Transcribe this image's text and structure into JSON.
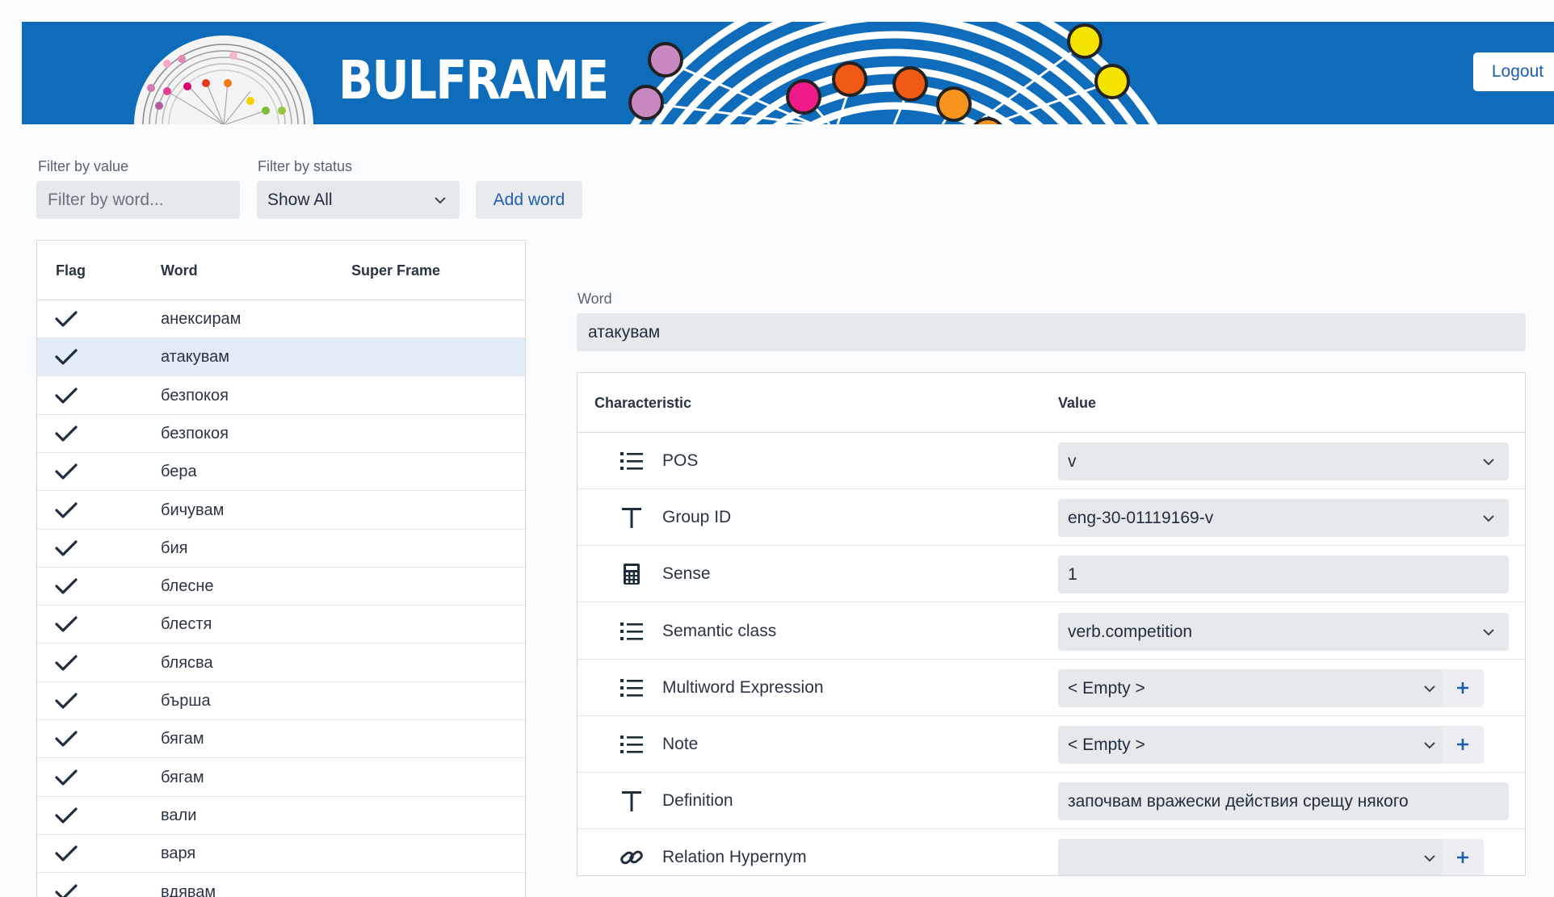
{
  "header": {
    "logo_text": "BULFRAME",
    "logout_label": "Logout"
  },
  "filters": {
    "value_label": "Filter by value",
    "value_placeholder": "Filter by word...",
    "status_label": "Filter by status",
    "status_selected": "Show All",
    "add_word_label": "Add word"
  },
  "word_table": {
    "columns": [
      "Flag",
      "Word",
      "Super Frame"
    ],
    "rows": [
      {
        "word": "анексирам",
        "selected": false
      },
      {
        "word": "атакувам",
        "selected": true
      },
      {
        "word": "безпокоя",
        "selected": false
      },
      {
        "word": "безпокоя",
        "selected": false
      },
      {
        "word": "бера",
        "selected": false
      },
      {
        "word": "бичувам",
        "selected": false
      },
      {
        "word": "бия",
        "selected": false
      },
      {
        "word": "блесне",
        "selected": false
      },
      {
        "word": "блестя",
        "selected": false
      },
      {
        "word": "блясва",
        "selected": false
      },
      {
        "word": "бърша",
        "selected": false
      },
      {
        "word": "бягам",
        "selected": false
      },
      {
        "word": "бягам",
        "selected": false
      },
      {
        "word": "вали",
        "selected": false
      },
      {
        "word": "варя",
        "selected": false
      },
      {
        "word": "вдявам",
        "selected": false
      }
    ]
  },
  "detail": {
    "word_label": "Word",
    "word_value": "атакувам",
    "columns": [
      "Characteristic",
      "Value"
    ],
    "rows": [
      {
        "icon": "list-icon",
        "name": "POS",
        "value": "v",
        "kind": "select",
        "add": false
      },
      {
        "icon": "text-t-icon",
        "name": "Group ID",
        "value": "eng-30-01119169-v",
        "kind": "select",
        "add": false
      },
      {
        "icon": "calculator-icon",
        "name": "Sense",
        "value": "1",
        "kind": "input",
        "add": false
      },
      {
        "icon": "list-icon",
        "name": "Semantic class",
        "value": "verb.competition",
        "kind": "select",
        "add": false
      },
      {
        "icon": "list-icon",
        "name": "Multiword Expression",
        "value": "< Empty >",
        "kind": "select",
        "add": true
      },
      {
        "icon": "list-icon",
        "name": "Note",
        "value": "< Empty >",
        "kind": "select",
        "add": true
      },
      {
        "icon": "text-t-icon",
        "name": "Definition",
        "value": "започвам вражески действия срещу някого",
        "kind": "input",
        "add": false
      },
      {
        "icon": "link-icon",
        "name": "Relation Hypernym",
        "value": "",
        "kind": "select",
        "add": true
      }
    ]
  }
}
